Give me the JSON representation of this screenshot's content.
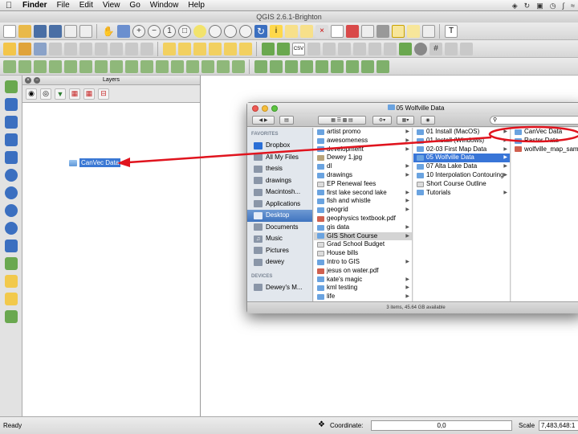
{
  "menubar": {
    "app": "Finder",
    "items": [
      "File",
      "Edit",
      "View",
      "Go",
      "Window",
      "Help"
    ]
  },
  "window_title": "QGIS 2.6.1-Brighton",
  "layers_panel": {
    "title": "Layers",
    "items": [
      {
        "label": "CanVec Data"
      }
    ]
  },
  "finder": {
    "title": "05 Wolfville Data",
    "search_placeholder": "",
    "sidebar": {
      "favorites_heading": "FAVORITES",
      "favorites": [
        "Dropbox",
        "All My Files",
        "thesis",
        "drawings",
        "Macintosh...",
        "Applications",
        "Desktop",
        "Documents",
        "Music",
        "Pictures",
        "dewey"
      ],
      "selected": "Desktop",
      "devices_heading": "DEVICES",
      "devices": [
        "Dewey's M..."
      ]
    },
    "column1": [
      {
        "name": "artist promo",
        "type": "folder",
        "arrow": true
      },
      {
        "name": "awesomeness",
        "type": "folder",
        "arrow": true
      },
      {
        "name": "development",
        "type": "folder",
        "arrow": true
      },
      {
        "name": "Dewey 1.jpg",
        "type": "image",
        "arrow": false
      },
      {
        "name": "dl",
        "type": "folder",
        "arrow": true
      },
      {
        "name": "drawings",
        "type": "folder",
        "arrow": true
      },
      {
        "name": "EP Renewal fees",
        "type": "doc",
        "arrow": false
      },
      {
        "name": "first lake second lake",
        "type": "folder",
        "arrow": true
      },
      {
        "name": "fish and whistle",
        "type": "folder",
        "arrow": true
      },
      {
        "name": "geogrid",
        "type": "folder",
        "arrow": true
      },
      {
        "name": "geophysics textbook.pdf",
        "type": "pdf",
        "arrow": false
      },
      {
        "name": "gis data",
        "type": "folder",
        "arrow": true
      },
      {
        "name": "GIS Short Course",
        "type": "folder",
        "arrow": true,
        "state": "selected"
      },
      {
        "name": "Grad School Budget",
        "type": "doc",
        "arrow": false
      },
      {
        "name": "House bills",
        "type": "doc",
        "arrow": false
      },
      {
        "name": "Intro to GIS",
        "type": "folder",
        "arrow": true
      },
      {
        "name": "jesus on water.pdf",
        "type": "pdf",
        "arrow": false
      },
      {
        "name": "kate's magic",
        "type": "folder",
        "arrow": true
      },
      {
        "name": "kml testing",
        "type": "folder",
        "arrow": true
      },
      {
        "name": "life",
        "type": "folder",
        "arrow": true
      }
    ],
    "column2": [
      {
        "name": "01 Install (MacOS)",
        "type": "folder",
        "arrow": true
      },
      {
        "name": "01 Install (Windows)",
        "type": "folder",
        "arrow": true
      },
      {
        "name": "02-03 First Map Data",
        "type": "folder",
        "arrow": true
      },
      {
        "name": "05 Wolfville Data",
        "type": "folder",
        "arrow": true,
        "state": "active"
      },
      {
        "name": "07 Alta Lake Data",
        "type": "folder",
        "arrow": true
      },
      {
        "name": "10 Interpolation Contouring",
        "type": "folder",
        "arrow": true
      },
      {
        "name": "Short Course Outline",
        "type": "doc",
        "arrow": false
      },
      {
        "name": "Tutorials",
        "type": "folder",
        "arrow": true
      }
    ],
    "column3": [
      {
        "name": "CanVec Data",
        "type": "folder",
        "arrow": false
      },
      {
        "name": "Raster Data",
        "type": "folder",
        "arrow": false
      },
      {
        "name": "wolfville_map_samp",
        "type": "pdf",
        "arrow": false
      }
    ],
    "status": "3 items, 45.64 GB available"
  },
  "statusbar": {
    "ready": "Ready",
    "coordinate_label": "Coordinate:",
    "coordinate_value": "0,0",
    "scale_label": "Scale",
    "scale_value": "7,483,648:1"
  },
  "colors": {
    "accent": "#3875d7",
    "annotation": "#e0141e",
    "folder": "#6aa3e0"
  }
}
